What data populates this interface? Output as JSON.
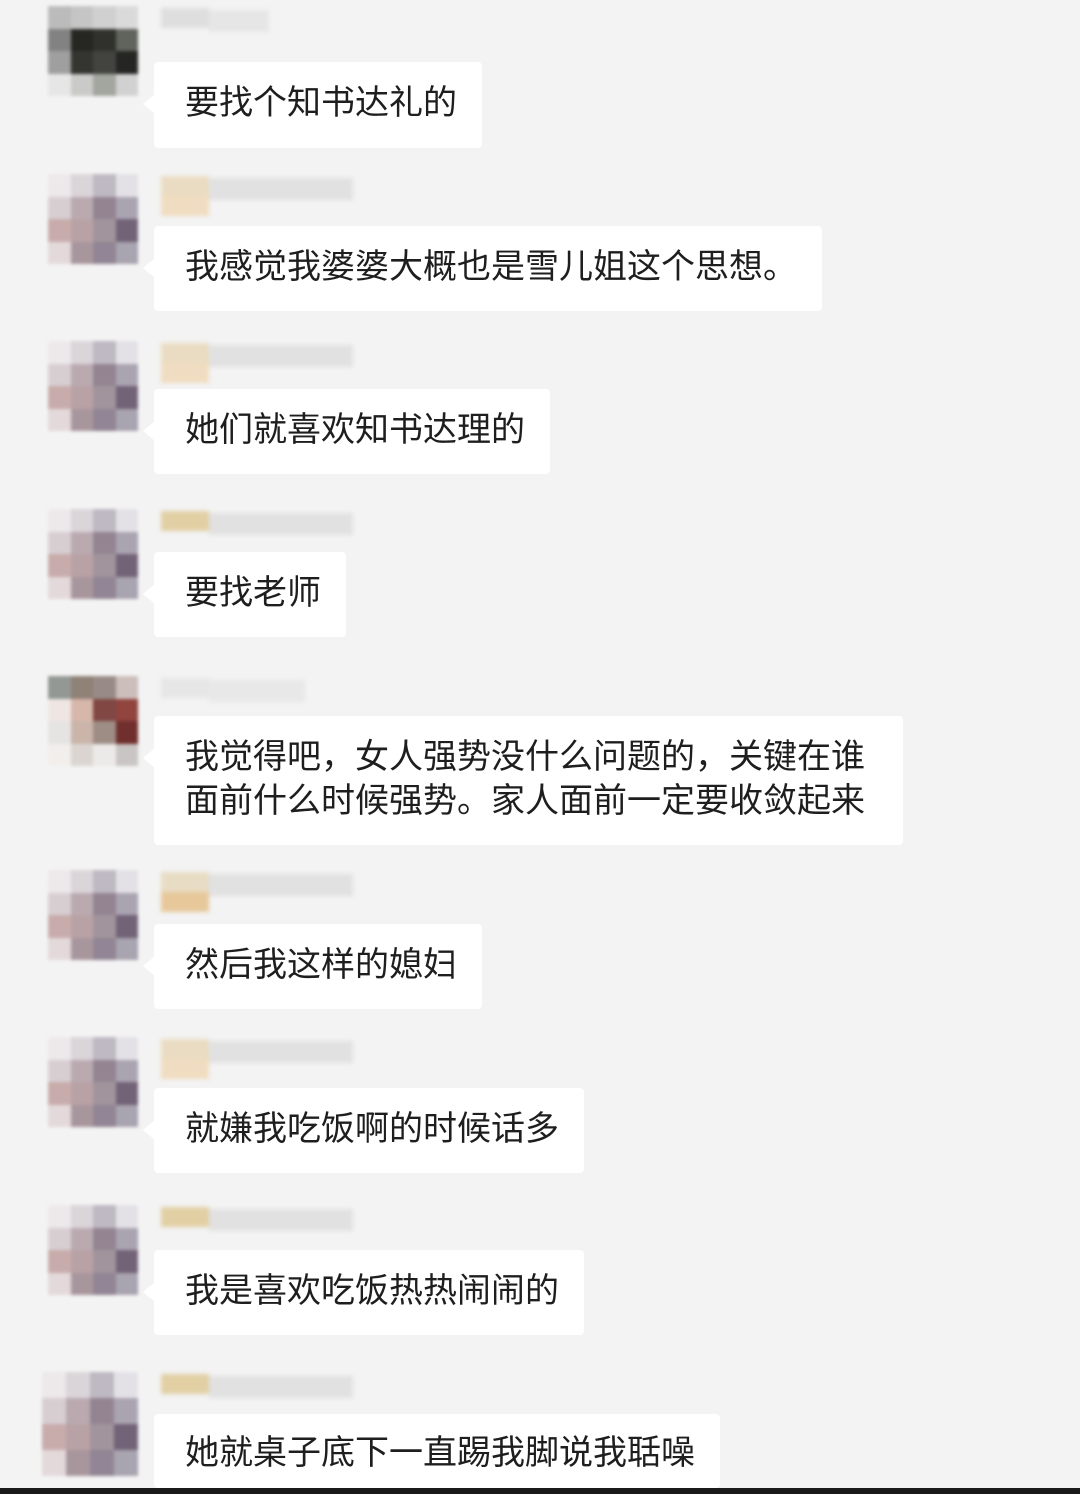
{
  "chat": {
    "messages": [
      {
        "text": "要找个知书达礼的"
      },
      {
        "text": "我感觉我婆婆大概也是雪儿姐这个思想。"
      },
      {
        "text": "她们就喜欢知书达理的"
      },
      {
        "text": "要找老师"
      },
      {
        "text": "我觉得吧，女人强势没什么问题的，关键在谁面前什么时候强势。家人面前一定要收敛起来"
      },
      {
        "text": "然后我这样的媳妇"
      },
      {
        "text": "就嫌我吃饭啊的时候话多"
      },
      {
        "text": "我是喜欢吃饭热热闹闹的"
      },
      {
        "text": "她就桌子底下一直踢我脚说我聒噪"
      }
    ]
  },
  "colors": {
    "background": "#f3f3f3",
    "bubble": "#ffffff",
    "text": "#1e1e1e"
  }
}
